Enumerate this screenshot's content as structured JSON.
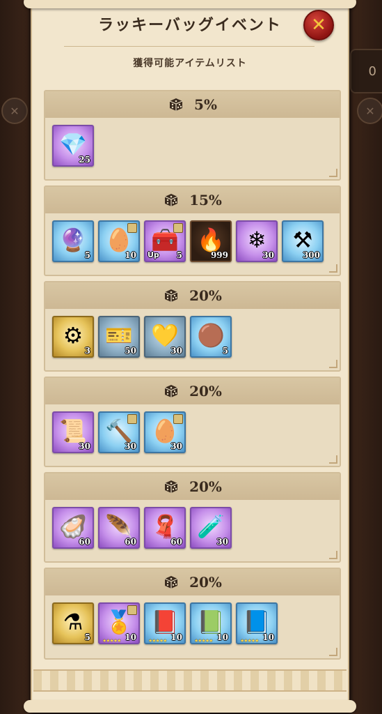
{
  "header": {
    "title": "ラッキーバッグイベント",
    "subtitle": "獲得可能アイテムリスト",
    "close_label": "✕"
  },
  "background": {
    "counter_fragment": "0"
  },
  "sections": [
    {
      "percent": "5%",
      "items": [
        {
          "name": "blue-diamond",
          "icon": "💎",
          "count": "25",
          "rarity": "purple"
        }
      ]
    },
    {
      "percent": "15%",
      "items": [
        {
          "name": "dark-orb",
          "icon": "🔮",
          "count": "5",
          "rarity": "blue"
        },
        {
          "name": "purple-crystal",
          "icon": "🥚",
          "count": "10",
          "rarity": "blue",
          "corner": true
        },
        {
          "name": "treasure-box",
          "icon": "🧰",
          "count": "5",
          "rarity": "purple",
          "up": "Up",
          "corner": true
        },
        {
          "name": "fire-gem",
          "icon": "🔥",
          "count": "999",
          "rarity": "dark"
        },
        {
          "name": "crystal-shard",
          "icon": "❄",
          "count": "30",
          "rarity": "purple"
        },
        {
          "name": "anvil",
          "icon": "⚒",
          "count": "300",
          "rarity": "blue"
        }
      ]
    },
    {
      "percent": "20%",
      "items": [
        {
          "name": "gear-cluster",
          "icon": "⚙",
          "count": "3",
          "rarity": "gold"
        },
        {
          "name": "ticket",
          "icon": "🎫",
          "count": "50",
          "rarity": "steel"
        },
        {
          "name": "gold-heart",
          "icon": "💛",
          "count": "30",
          "rarity": "steel"
        },
        {
          "name": "bronze-orbs",
          "icon": "🟤",
          "count": "5",
          "rarity": "blue"
        }
      ]
    },
    {
      "percent": "20%",
      "items": [
        {
          "name": "silver-cloth",
          "icon": "📜",
          "count": "30",
          "rarity": "purple"
        },
        {
          "name": "war-hammer",
          "icon": "🔨",
          "count": "30",
          "rarity": "blue",
          "corner": true
        },
        {
          "name": "purple-crystal-2",
          "icon": "🥚",
          "count": "30",
          "rarity": "blue",
          "corner": true
        }
      ]
    },
    {
      "percent": "20%",
      "items": [
        {
          "name": "horn",
          "icon": "🦪",
          "count": "60",
          "rarity": "purple"
        },
        {
          "name": "wing",
          "icon": "🪶",
          "count": "60",
          "rarity": "purple"
        },
        {
          "name": "red-cloth",
          "icon": "🧣",
          "count": "60",
          "rarity": "purple"
        },
        {
          "name": "potion-bottle",
          "icon": "🧪",
          "count": "30",
          "rarity": "purple"
        }
      ]
    },
    {
      "percent": "20%",
      "items": [
        {
          "name": "orange-potion",
          "icon": "⚗",
          "count": "5",
          "rarity": "gold"
        },
        {
          "name": "gold-medal",
          "icon": "🏅",
          "count": "10",
          "rarity": "purple",
          "corner": true,
          "stars": "★★★★★"
        },
        {
          "name": "red-book",
          "icon": "📕",
          "count": "10",
          "rarity": "blue",
          "stars": "★★★★★"
        },
        {
          "name": "green-book",
          "icon": "📗",
          "count": "10",
          "rarity": "blue",
          "stars": "★★★★★"
        },
        {
          "name": "blue-book",
          "icon": "📘",
          "count": "10",
          "rarity": "blue",
          "stars": "★★★★★"
        }
      ]
    }
  ]
}
